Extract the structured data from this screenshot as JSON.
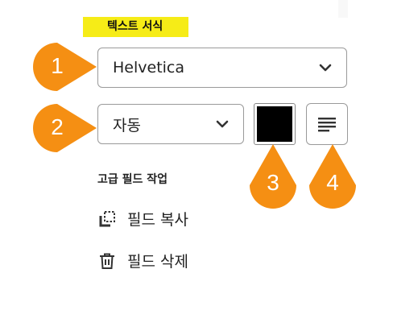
{
  "panel": {
    "title": "텍스트 서식",
    "font_select": {
      "value": "Helvetica"
    },
    "size_select": {
      "value": "자동"
    },
    "text_color": "#000000",
    "align_button": {
      "icon": "align-left-icon"
    }
  },
  "advanced": {
    "title": "고급 필드 작업",
    "copy_label": "필드 복사",
    "delete_label": "필드 삭제"
  },
  "callouts": [
    "1",
    "2",
    "3",
    "4"
  ],
  "colors": {
    "highlight": "#f6ec17",
    "callout": "#f58f13",
    "border": "#9a9a9a"
  }
}
